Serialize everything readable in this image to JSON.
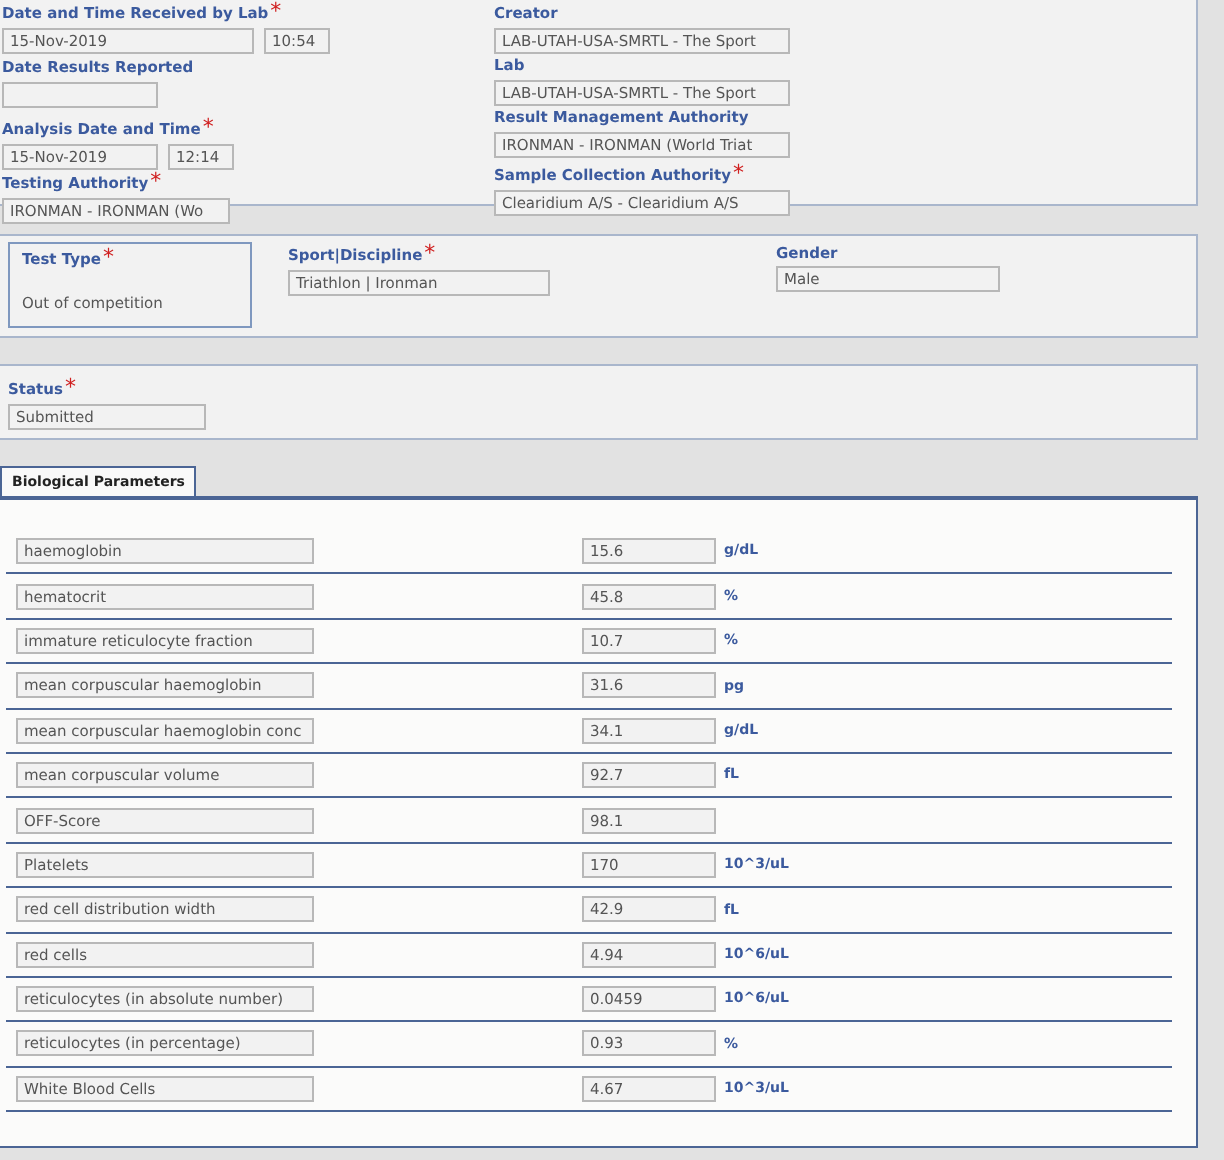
{
  "header_left": [
    {
      "label": "Date and Time Received by Lab",
      "asterisk": "*",
      "fields": [
        {
          "value": "15-Nov-2019",
          "kind": "wide"
        },
        {
          "value": "10:54",
          "kind": "time"
        }
      ]
    },
    {
      "label": "Date Results Reported",
      "fields": [
        {
          "kind": "date"
        }
      ]
    },
    {
      "label": "Analysis Date and Time",
      "asterisk": "*",
      "fields": [
        {
          "value": "15-Nov-2019",
          "kind": "date"
        },
        {
          "value": "12:14",
          "kind": "time"
        }
      ]
    },
    {
      "label": "Testing Authority",
      "asterisk": "*",
      "fields": [
        {
          "value": "IRONMAN - IRONMAN (Wo",
          "kind": "auth"
        }
      ]
    }
  ],
  "header_right": [
    {
      "label": "Creator",
      "value": "LAB-UTAH-USA-SMRTL - The Sport"
    },
    {
      "label": "Lab",
      "value": "LAB-UTAH-USA-SMRTL - The Sport"
    },
    {
      "label": "Result Management Authority",
      "value": "IRONMAN - IRONMAN (World Triat"
    },
    {
      "label": "Sample Collection Authority",
      "asterisk": "*",
      "value": "Clearidium A/S - Clearidium A/S"
    }
  ],
  "test_type": {
    "label": "Test Type",
    "asterisk": "*",
    "value": "Out of competition"
  },
  "sport": {
    "label": "Sport|Discipline",
    "asterisk": "*",
    "value": "Triathlon | Ironman"
  },
  "gender": {
    "label": "Gender",
    "value": "Male"
  },
  "status": {
    "label": "Status",
    "asterisk": "*",
    "value": "Submitted"
  },
  "tabs": [
    {
      "label": "Biological Parameters",
      "selected": true
    }
  ],
  "parameters": [
    {
      "name": "haemoglobin",
      "value": "15.6",
      "unit": "g/dL"
    },
    {
      "name": "hematocrit",
      "value": "45.8",
      "unit": "%"
    },
    {
      "name": "immature reticulocyte fraction",
      "value": "10.7",
      "unit": "%"
    },
    {
      "name": "mean corpuscular haemoglobin",
      "value": "31.6",
      "unit": "pg"
    },
    {
      "name": "mean corpuscular haemoglobin conc",
      "value": "34.1",
      "unit": "g/dL"
    },
    {
      "name": "mean corpuscular volume",
      "value": "92.7",
      "unit": "fL"
    },
    {
      "name": "OFF-Score",
      "value": "98.1"
    },
    {
      "name": "Platelets",
      "value": "170",
      "unit": "10^3/uL"
    },
    {
      "name": "red cell distribution width",
      "value": "42.9",
      "unit": "fL"
    },
    {
      "name": "red cells",
      "value": "4.94",
      "unit": "10^6/uL"
    },
    {
      "name": "reticulocytes (in absolute number)",
      "value": "0.0459",
      "unit": "10^6/uL"
    },
    {
      "name": "reticulocytes (in percentage)",
      "value": "0.93",
      "unit": "%"
    },
    {
      "name": "White Blood Cells",
      "value": "4.67",
      "unit": "10^3/uL"
    }
  ]
}
